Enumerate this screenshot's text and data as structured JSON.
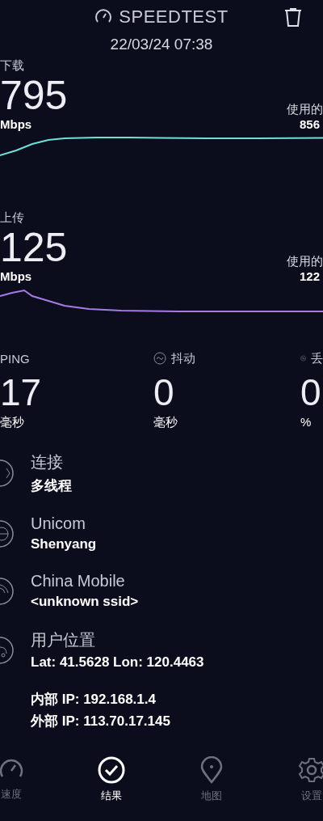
{
  "header": {
    "title": "SPEEDTEST",
    "datetime": "22/03/24 07:38"
  },
  "results": [
    {
      "kind": "download",
      "label": "下载",
      "value": "795",
      "unit": "Mbps",
      "data_label": "使用的",
      "data_value": "856"
    },
    {
      "kind": "upload",
      "label": "上传",
      "value": "125",
      "unit": "Mbps",
      "data_label": "使用的",
      "data_value": "122"
    }
  ],
  "metrics": [
    {
      "kind": "ping",
      "label": "PING",
      "value": "17",
      "unit": "毫秒"
    },
    {
      "kind": "jitter",
      "label": "抖动",
      "value": "0",
      "unit": "毫秒"
    },
    {
      "kind": "loss",
      "label": "丢",
      "value": "0",
      "unit": "%"
    }
  ],
  "info": [
    {
      "kind": "connection",
      "title": "连接",
      "detail": "多线程"
    },
    {
      "kind": "server",
      "title": "Unicom",
      "detail": "Shenyang"
    },
    {
      "kind": "wifi",
      "title": "China Mobile",
      "detail": "<unknown ssid>"
    },
    {
      "kind": "location",
      "title": "用户位置",
      "detail": "Lat: 41.5628 Lon: 120.4463"
    }
  ],
  "ip_lines": [
    "内部 IP: 192.168.1.4",
    "外部 IP: 113.70.17.145"
  ],
  "nav": [
    {
      "kind": "speed",
      "label": "速度",
      "selected": false
    },
    {
      "kind": "results",
      "label": "结果",
      "selected": true
    },
    {
      "kind": "map",
      "label": "地图",
      "selected": false
    },
    {
      "kind": "settings",
      "label": "设置",
      "selected": false
    }
  ]
}
